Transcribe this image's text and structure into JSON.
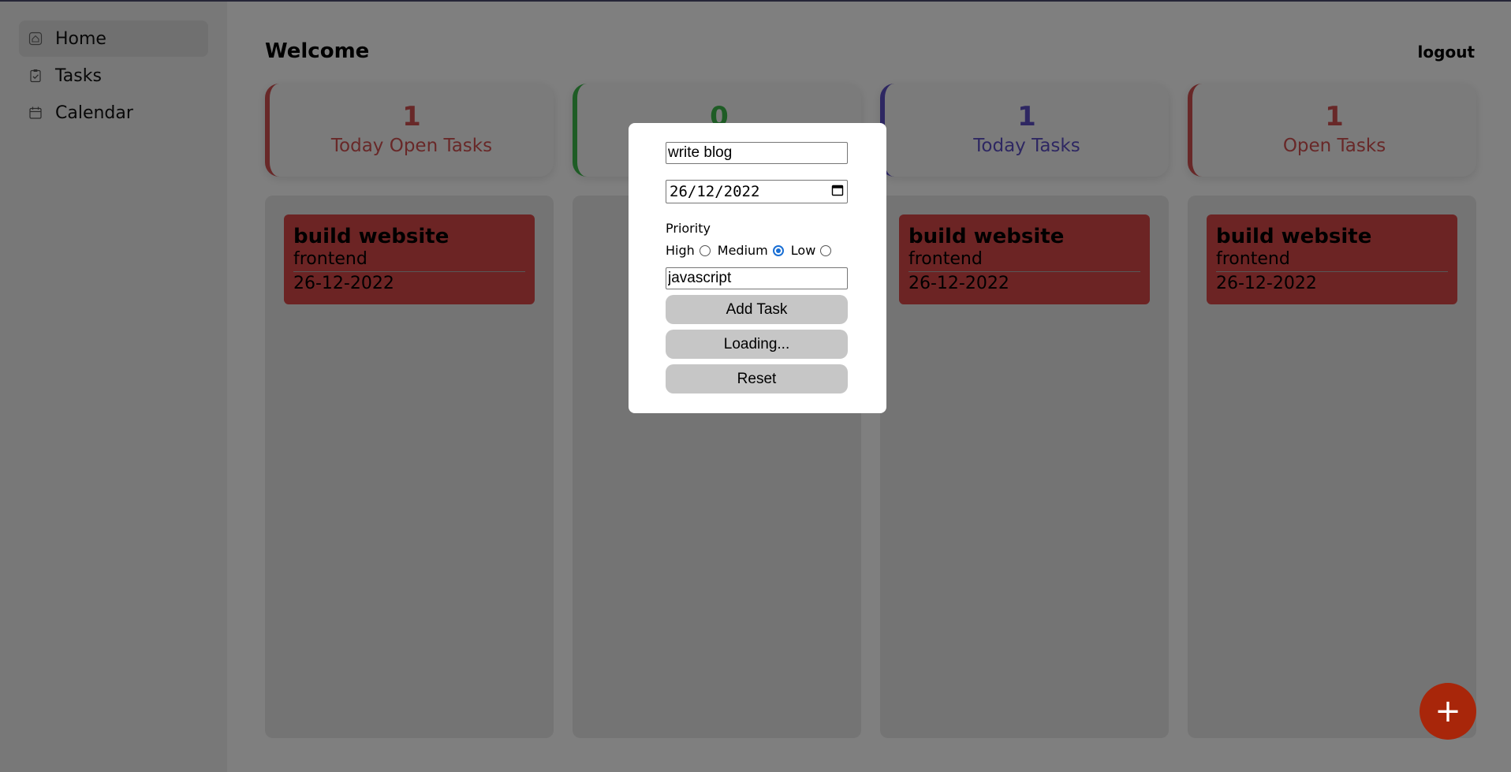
{
  "sidebar": {
    "items": [
      {
        "label": "Home",
        "icon": "home-icon",
        "active": true
      },
      {
        "label": "Tasks",
        "icon": "tasks-icon",
        "active": false
      },
      {
        "label": "Calendar",
        "icon": "calendar-icon",
        "active": false
      }
    ]
  },
  "header": {
    "title": "Welcome",
    "logout_label": "logout"
  },
  "stats": [
    {
      "count": "1",
      "label": "Today Open Tasks",
      "color": "#d05050"
    },
    {
      "count": "0",
      "label": "",
      "color": "#3cb84a"
    },
    {
      "count": "1",
      "label": "Today Tasks",
      "color": "#5c4fc4"
    },
    {
      "count": "1",
      "label": "Open Tasks",
      "color": "#d05050"
    }
  ],
  "columns": [
    {
      "tasks": [
        {
          "title": "build website",
          "tag": "frontend",
          "date": "26-12-2022"
        }
      ]
    },
    {
      "tasks": []
    },
    {
      "tasks": [
        {
          "title": "build website",
          "tag": "frontend",
          "date": "26-12-2022"
        }
      ]
    },
    {
      "tasks": [
        {
          "title": "build website",
          "tag": "frontend",
          "date": "26-12-2022"
        }
      ]
    }
  ],
  "modal": {
    "title_value": "write blog",
    "date_value": "26/12/2022",
    "priority_label": "Priority",
    "priority_options": [
      "High",
      "Medium",
      "Low"
    ],
    "priority_selected": "Medium",
    "tag_value": "javascript",
    "add_label": "Add Task",
    "loading_label": "Loading...",
    "reset_label": "Reset"
  },
  "fab_label": "+",
  "colors": {
    "task_card": "#d94848",
    "fab": "#a8260a",
    "accent_radio": "#1a6fd4"
  }
}
